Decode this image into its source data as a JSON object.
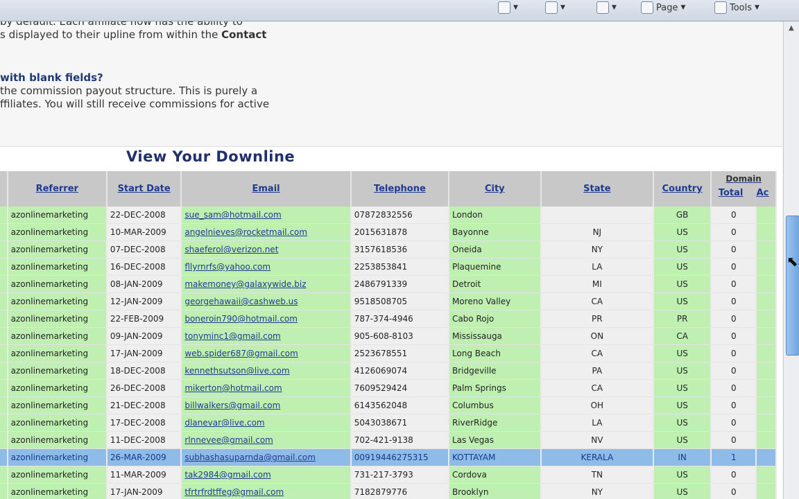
{
  "toolbar": {
    "page_label": "Page",
    "tools_label": "Tools"
  },
  "faq": {
    "line1": "by default. Each affiliate now has the ability to",
    "line2_prefix": "s displayed to their upline from within the ",
    "line2_bold": "Contact",
    "question": "with blank fields?",
    "answer1": "the commission payout structure. This is purely a",
    "answer2": "ffiliates. You will still receive commissions for active"
  },
  "title": "View Your Downline",
  "table": {
    "headers": {
      "referrer": "Referrer",
      "start_date": "Start Date",
      "email": "Email",
      "telephone": "Telephone",
      "city": "City",
      "state": "State",
      "country": "Country",
      "domain_group": "Domain",
      "domain_total": "Total",
      "domain_active": "Ac"
    },
    "rows": [
      {
        "referrer": "azonlinemarketing",
        "start_date": "22-DEC-2008",
        "email": "sue_sam@hotmail.com",
        "telephone": "07872832556",
        "city": "London",
        "state": "",
        "country": "GB",
        "total": "0"
      },
      {
        "referrer": "azonlinemarketing",
        "start_date": "10-MAR-2009",
        "email": "angelnieves@rocketmail.com",
        "telephone": "2015631878",
        "city": "Bayonne",
        "state": "NJ",
        "country": "US",
        "total": "0"
      },
      {
        "referrer": "azonlinemarketing",
        "start_date": "07-DEC-2008",
        "email": "shaeferol@verizon.net",
        "telephone": "3157618536",
        "city": "Oneida",
        "state": "NY",
        "country": "US",
        "total": "0"
      },
      {
        "referrer": "azonlinemarketing",
        "start_date": "16-DEC-2008",
        "email": "fllyrnrfs@yahoo.com",
        "telephone": "2253853841",
        "city": "Plaquemine",
        "state": "LA",
        "country": "US",
        "total": "0"
      },
      {
        "referrer": "azonlinemarketing",
        "start_date": "08-JAN-2009",
        "email": "makemoney@galaxywide.biz",
        "telephone": "2486791339",
        "city": "Detroit",
        "state": "MI",
        "country": "US",
        "total": "0"
      },
      {
        "referrer": "azonlinemarketing",
        "start_date": "12-JAN-2009",
        "email": "georgehawaii@cashweb.us",
        "telephone": "9518508705",
        "city": "Moreno Valley",
        "state": "CA",
        "country": "US",
        "total": "0"
      },
      {
        "referrer": "azonlinemarketing",
        "start_date": "22-FEB-2009",
        "email": "boneroin790@hotmail.com",
        "telephone": "787-374-4946",
        "city": "Cabo Rojo",
        "state": "PR",
        "country": "PR",
        "total": "0"
      },
      {
        "referrer": "azonlinemarketing",
        "start_date": "09-JAN-2009",
        "email": "tonyminc1@gmail.com",
        "telephone": "905-608-8103",
        "city": "Mississauga",
        "state": "ON",
        "country": "CA",
        "total": "0"
      },
      {
        "referrer": "azonlinemarketing",
        "start_date": "17-JAN-2009",
        "email": "web.spider687@gmail.com",
        "telephone": "2523678551",
        "city": "Long Beach",
        "state": "CA",
        "country": "US",
        "total": "0"
      },
      {
        "referrer": "azonlinemarketing",
        "start_date": "18-DEC-2008",
        "email": "kennethsutson@live.com",
        "telephone": "4126069074",
        "city": "Bridgeville",
        "state": "PA",
        "country": "US",
        "total": "0"
      },
      {
        "referrer": "azonlinemarketing",
        "start_date": "26-DEC-2008",
        "email": "mikerton@hotmail.com",
        "telephone": "7609529424",
        "city": "Palm Springs",
        "state": "CA",
        "country": "US",
        "total": "0"
      },
      {
        "referrer": "azonlinemarketing",
        "start_date": "21-DEC-2008",
        "email": "billwalkers@gmail.com",
        "telephone": "6143562048",
        "city": "Columbus",
        "state": "OH",
        "country": "US",
        "total": "0"
      },
      {
        "referrer": "azonlinemarketing",
        "start_date": "17-DEC-2008",
        "email": "dlanevar@live.com",
        "telephone": "5043038671",
        "city": "RiverRidge",
        "state": "LA",
        "country": "US",
        "total": "0"
      },
      {
        "referrer": "azonlinemarketing",
        "start_date": "11-DEC-2008",
        "email": "rlnnevee@gmail.com",
        "telephone": "702-421-9138",
        "city": "Las Vegas",
        "state": "NV",
        "country": "US",
        "total": "0"
      },
      {
        "referrer": "azonlinemarketing",
        "start_date": "26-MAR-2009",
        "email": "subhashasuparnda@gmail.com",
        "telephone": "00919446275315",
        "city": "KOTTAYAM",
        "state": "KERALA",
        "country": "IN",
        "total": "1"
      },
      {
        "referrer": "azonlinemarketing",
        "start_date": "11-MAR-2009",
        "email": "tak2984@gmail.com",
        "telephone": "731-217-3793",
        "city": "Cordova",
        "state": "TN",
        "country": "US",
        "total": "0"
      },
      {
        "referrer": "azonlinemarketing",
        "start_date": "17-JAN-2009",
        "email": "tfrtrfrdtffeg@gmail.com",
        "telephone": "7182879776",
        "city": "Brooklyn",
        "state": "NY",
        "country": "US",
        "total": "0"
      }
    ]
  },
  "colors": {
    "row_green": "#bff0b2",
    "row_white": "#efefef",
    "selected_row": "#8fbbe8",
    "header_bg": "#c8c8c8",
    "title_color": "#1f2f6e"
  }
}
